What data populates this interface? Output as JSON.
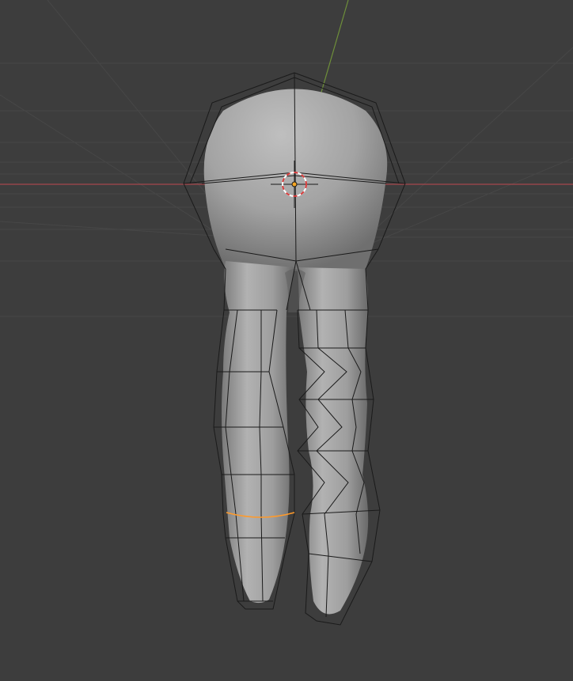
{
  "viewport": {
    "view": "3d-viewport",
    "mode": "edit",
    "object": "mesh",
    "icons": [
      "3d-cursor-icon",
      "object-origin-icon"
    ]
  },
  "axes": {
    "x_color": "#a5474d",
    "y_color": "#6e8f3a",
    "grid_color": "#4a4a4a"
  },
  "mesh": {
    "surface_color": "#9a9a9a",
    "wire_color": "#1a1a1a",
    "selection_color": "#ff9a2a"
  }
}
